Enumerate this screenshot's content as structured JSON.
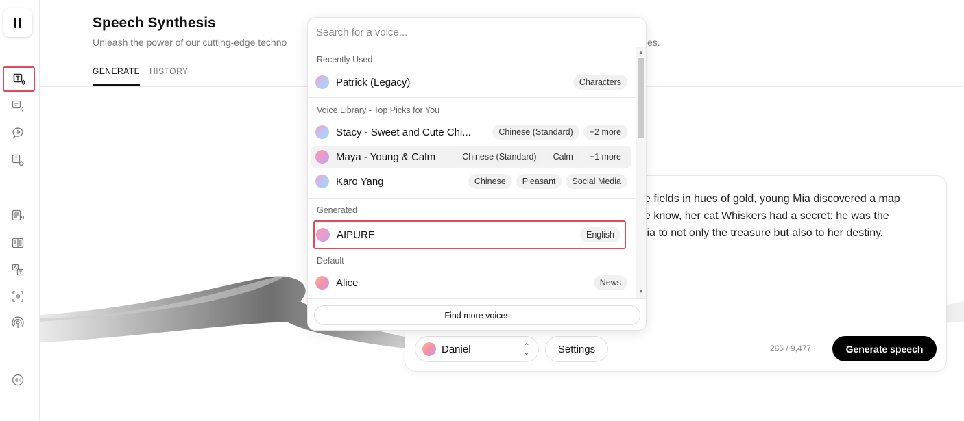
{
  "sidebar": {
    "items": [
      {
        "icon": "text-to-speech-icon"
      },
      {
        "icon": "speech-to-speech-icon"
      },
      {
        "icon": "voice-chat-icon"
      },
      {
        "icon": "voice-settings-icon"
      },
      {
        "icon": "projects-icon"
      },
      {
        "icon": "dubbing-icon"
      },
      {
        "icon": "translate-icon"
      },
      {
        "icon": "voice-isolator-icon"
      },
      {
        "icon": "podcast-icon"
      },
      {
        "icon": "audio-native-icon"
      }
    ]
  },
  "header": {
    "title": "Speech Synthesis",
    "subtitle": "Unleash the power of our cutting-edge techno",
    "subtitle_tail": "es."
  },
  "tabs": [
    {
      "label": "GENERATE",
      "active": true
    },
    {
      "label": "HISTORY",
      "active": false
    }
  ],
  "dropdown": {
    "search_placeholder": "Search for a voice...",
    "sections": {
      "recent": {
        "label": "Recently Used",
        "voices": [
          {
            "name": "Patrick (Legacy)",
            "tags": [
              "Characters"
            ]
          }
        ]
      },
      "library": {
        "label": "Voice Library - Top Picks for You",
        "voices": [
          {
            "name": "Stacy - Sweet and Cute Chi...",
            "tags": [
              "Chinese (Standard)",
              "+2 more"
            ]
          },
          {
            "name": "Maya - Young & Calm",
            "tags": [
              "Chinese (Standard)",
              "Calm",
              "+1 more"
            ]
          },
          {
            "name": "Karo Yang",
            "tags": [
              "Chinese",
              "Pleasant",
              "Social Media"
            ]
          }
        ]
      },
      "generated": {
        "label": "Generated",
        "voices": [
          {
            "name": "AIPURE",
            "tags": [
              "English"
            ]
          }
        ]
      },
      "default": {
        "label": "Default",
        "voices": [
          {
            "name": "Alice",
            "tags": [
              "News"
            ]
          }
        ]
      }
    },
    "find_more_label": "Find more voices"
  },
  "editor": {
    "text_lines": [
      "e fields in hues of gold, young Mia discovered a map",
      "e know, her cat Whiskers had a secret: he was the",
      "lia to not only the treasure but also to her destiny."
    ],
    "selected_voice": "Daniel",
    "settings_label": "Settings",
    "char_count": "285 / 9,477",
    "generate_label": "Generate speech"
  },
  "colors": {
    "highlight": "#e5475b",
    "primary_button": "#000000"
  }
}
